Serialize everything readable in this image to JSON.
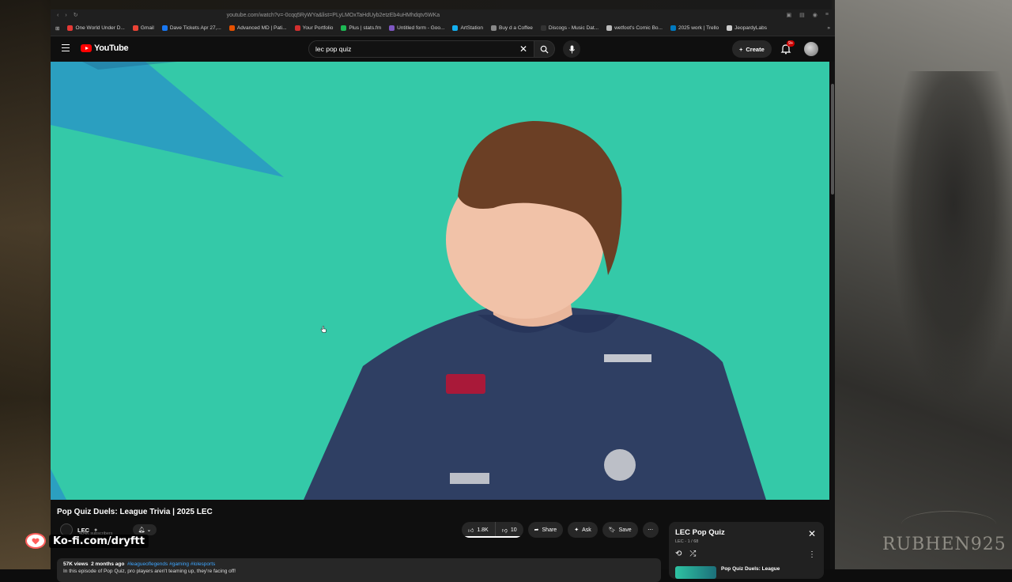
{
  "browser": {
    "url": "youtube.com/watch?v=-0cqq5RyWYa&list=PLyLMOxTaHdUyb2etzEb4uHMhdqtv5WKa",
    "bookmarks": [
      {
        "label": "One World Under D...",
        "color": "#e53935"
      },
      {
        "label": "Gmail",
        "color": "#ea4335"
      },
      {
        "label": "Dave Tickets Apr 27,...",
        "color": "#1877f2"
      },
      {
        "label": "Advanced MD | Pati...",
        "color": "#e65100"
      },
      {
        "label": "Your Portfolio",
        "color": "#d32f2f"
      },
      {
        "label": "Plus | stats.fm",
        "color": "#1db954"
      },
      {
        "label": "Untitled form - Goo...",
        "color": "#7e57c2"
      },
      {
        "label": "ArtStation",
        "color": "#13aff0"
      },
      {
        "label": "Buy d a Coffee",
        "color": "#888888"
      },
      {
        "label": "Discogs - Music Dat...",
        "color": "#333333"
      },
      {
        "label": "wetfoot's Comic Bo...",
        "color": "#bbbbbb"
      },
      {
        "label": "2025 work | Trello",
        "color": "#0079bf"
      },
      {
        "label": "JeopardyLabs",
        "color": "#cccccc"
      }
    ],
    "bookmarks_more": "»"
  },
  "youtube": {
    "logo_text": "YouTube",
    "search_value": "lec pop quiz",
    "create_label": "Create",
    "notification_badge": "9+"
  },
  "video": {
    "title": "Pop Quiz Duels: League Trivia | 2025 LEC",
    "channel": "LEC",
    "subscribers": "404K subscribers",
    "likes": "1.8K",
    "dislikes": "10",
    "like_ratio": 0.99,
    "share_label": "Share",
    "ask_label": "Ask",
    "save_label": "Save",
    "views": "57K views",
    "age": "2 months ago",
    "tags": "#leagueoflegends #gaming #lolesports",
    "description": "In this episode of Pop Quiz, pro players aren't teaming up, they're facing off!"
  },
  "playlist": {
    "title": "LEC Pop Quiz",
    "position": "LEC - 1 / 68",
    "current_item": "Pop Quiz Duels: League"
  },
  "overlay": {
    "kofi": "Ko-fi.com/dryftt",
    "watermark": "RUBHEN925"
  },
  "colors": {
    "video_bg": "#34c9a8",
    "yt_red": "#ff0000",
    "link_blue": "#3ea6ff"
  }
}
